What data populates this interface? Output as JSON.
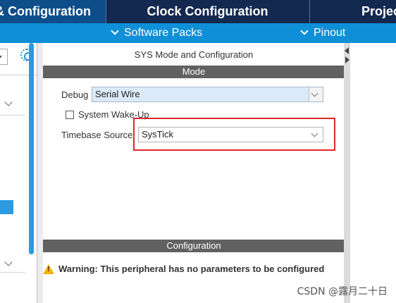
{
  "tabs": {
    "pinout_config": "Pinout & Configuration",
    "clock_config": "Clock Configuration",
    "project_manager": "Project Manager"
  },
  "subtoolbar": {
    "software_packs": "Software Packs",
    "pinout": "Pinout"
  },
  "panel": {
    "title": "SYS Mode and Configuration",
    "mode_header": "Mode",
    "config_header": "Configuration"
  },
  "mode": {
    "debug_label": "Debug",
    "debug_value": "Serial Wire",
    "wakeup_label": "System Wake-Up",
    "wakeup_checked": false,
    "timebase_label": "Timebase Source",
    "timebase_value": "SysTick"
  },
  "configuration": {
    "warning": "Warning: This peripheral has no parameters to be configured"
  },
  "colors": {
    "tab_bar": "#132a55",
    "active_tab": "#0d4d89",
    "subtoolbar": "#0f8fd7",
    "highlight_box": "#e0262b",
    "section_header": "#616161",
    "accent": "#2b9ae0"
  },
  "watermark": "CSDN @露月二十日"
}
